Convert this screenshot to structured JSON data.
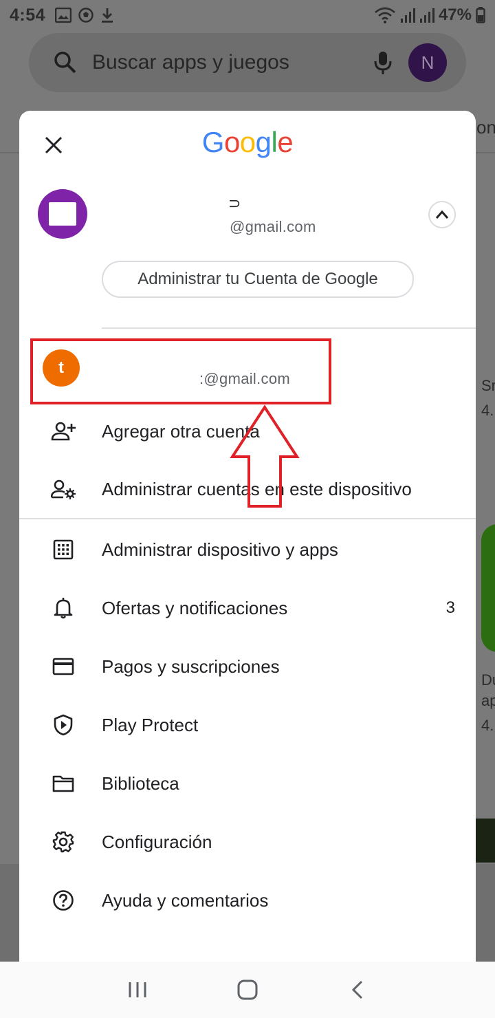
{
  "status_bar": {
    "time": "4:54",
    "battery": "47%",
    "icons_left": [
      "image-icon",
      "soccer-ball-icon",
      "download-icon"
    ],
    "icons_right": [
      "wifi-icon",
      "signal-icon",
      "signal-icon",
      "battery-icon"
    ]
  },
  "background": {
    "search_placeholder": "Buscar apps y juegos",
    "avatar_letter": "N",
    "peek_texts": [
      "on",
      "Sr",
      "4.",
      "Du",
      "ap",
      "4."
    ]
  },
  "sheet": {
    "logo": {
      "letters": [
        "G",
        "o",
        "o",
        "g",
        "l",
        "e"
      ],
      "colors": [
        "#4285F4",
        "#EA4335",
        "#FBBC05",
        "#4285F4",
        "#34A853",
        "#EA4335"
      ]
    },
    "primary_account": {
      "name": "⊃",
      "email": "@gmail.com",
      "avatar_color": "#7f23a8"
    },
    "manage_account_label": "Administrar tu Cuenta de Google",
    "other_account": {
      "avatar_letter": "t",
      "avatar_color": "#ef6c00",
      "email": ":@gmail.com"
    },
    "account_actions": [
      {
        "icon": "add-person-icon",
        "label": "Agregar otra cuenta"
      },
      {
        "icon": "manage-accounts-icon",
        "label": "Administrar cuentas en este dispositivo"
      }
    ],
    "menu_items": [
      {
        "icon": "apps-grid-icon",
        "label": "Administrar dispositivo y apps",
        "badge": ""
      },
      {
        "icon": "bell-icon",
        "label": "Ofertas y notificaciones",
        "badge": "3"
      },
      {
        "icon": "credit-card-icon",
        "label": "Pagos y suscripciones",
        "badge": ""
      },
      {
        "icon": "shield-play-icon",
        "label": "Play Protect",
        "badge": ""
      },
      {
        "icon": "folder-icon",
        "label": "Biblioteca",
        "badge": ""
      },
      {
        "icon": "gear-icon",
        "label": "Configuración",
        "badge": ""
      },
      {
        "icon": "help-icon",
        "label": "Ayuda y comentarios",
        "badge": ""
      }
    ]
  },
  "annotation": {
    "color": "#e02127"
  },
  "nav_bar": {
    "buttons": [
      "recents-icon",
      "home-icon",
      "back-icon"
    ]
  }
}
